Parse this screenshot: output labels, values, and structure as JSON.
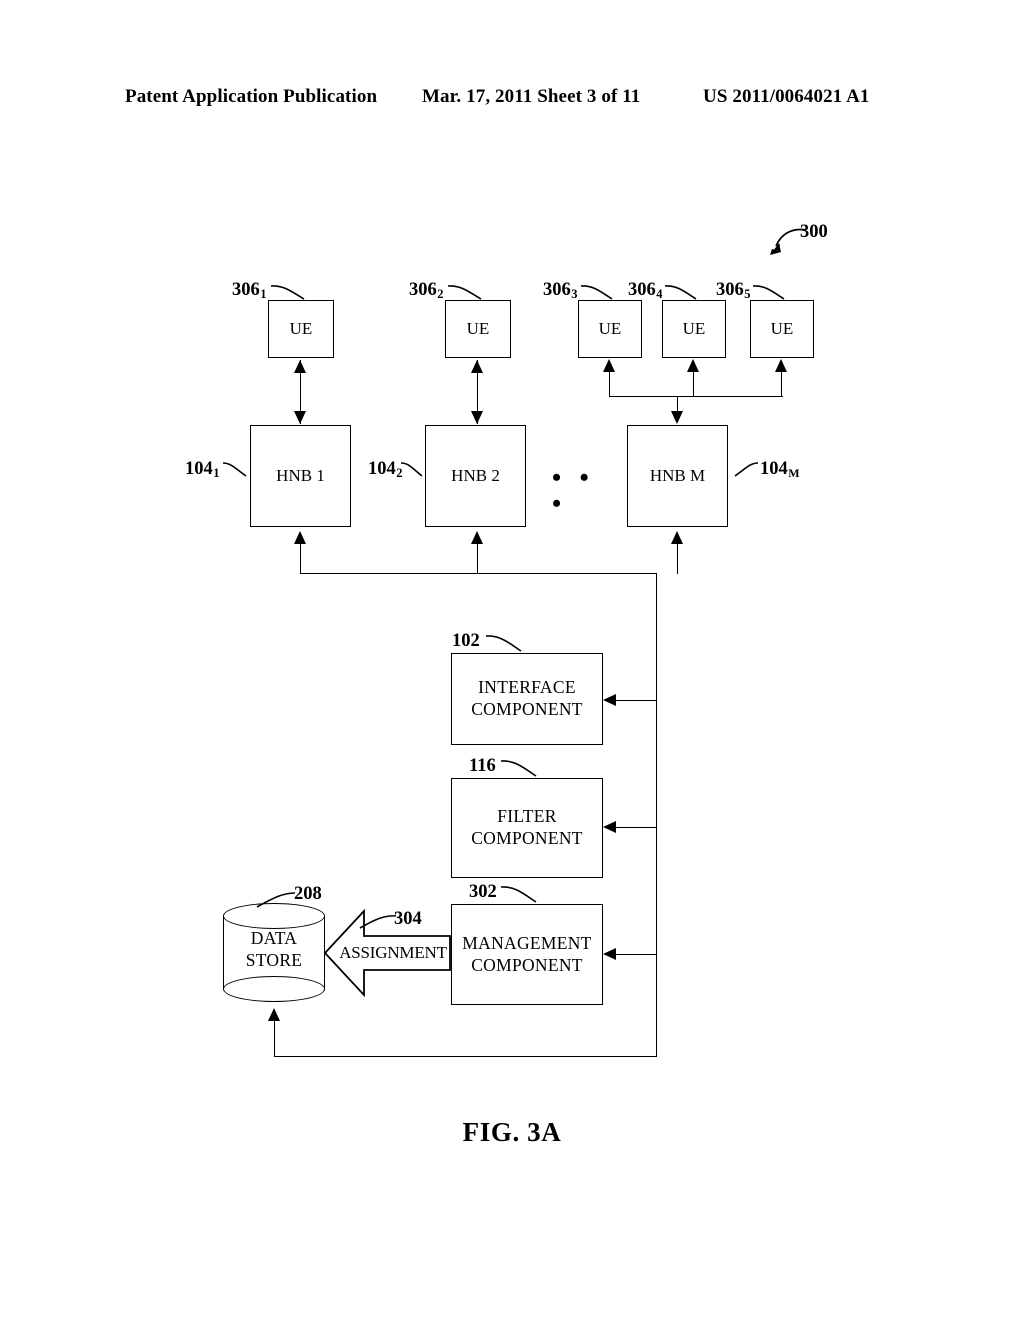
{
  "header": {
    "left": "Patent Application Publication",
    "middle": "Mar. 17, 2011  Sheet 3 of 11",
    "right": "US 2011/0064021 A1"
  },
  "figure": {
    "caption": "FIG. 3A",
    "overall_ref": "300"
  },
  "ue_nodes": [
    {
      "label": "UE",
      "ref": "306",
      "sub": "1"
    },
    {
      "label": "UE",
      "ref": "306",
      "sub": "2"
    },
    {
      "label": "UE",
      "ref": "306",
      "sub": "3"
    },
    {
      "label": "UE",
      "ref": "306",
      "sub": "4"
    },
    {
      "label": "UE",
      "ref": "306",
      "sub": "5"
    }
  ],
  "hnb_nodes": [
    {
      "label": "HNB 1",
      "ref": "104",
      "sub": "1"
    },
    {
      "label": "HNB 2",
      "ref": "104",
      "sub": "2"
    },
    {
      "label": "HNB M",
      "ref": "104",
      "sub": "M"
    }
  ],
  "hnb_ellipsis": "• • •",
  "components": [
    {
      "line1": "INTERFACE",
      "line2": "COMPONENT",
      "ref": "102"
    },
    {
      "line1": "FILTER",
      "line2": "COMPONENT",
      "ref": "116"
    },
    {
      "line1": "MANAGEMENT",
      "line2": "COMPONENT",
      "ref": "302"
    }
  ],
  "data_store": {
    "line1": "DATA",
    "line2": "STORE",
    "ref": "208"
  },
  "assignment": {
    "label": "ASSIGNMENT",
    "ref": "304"
  },
  "colors": {
    "ink": "#000000",
    "paper": "#ffffff"
  }
}
